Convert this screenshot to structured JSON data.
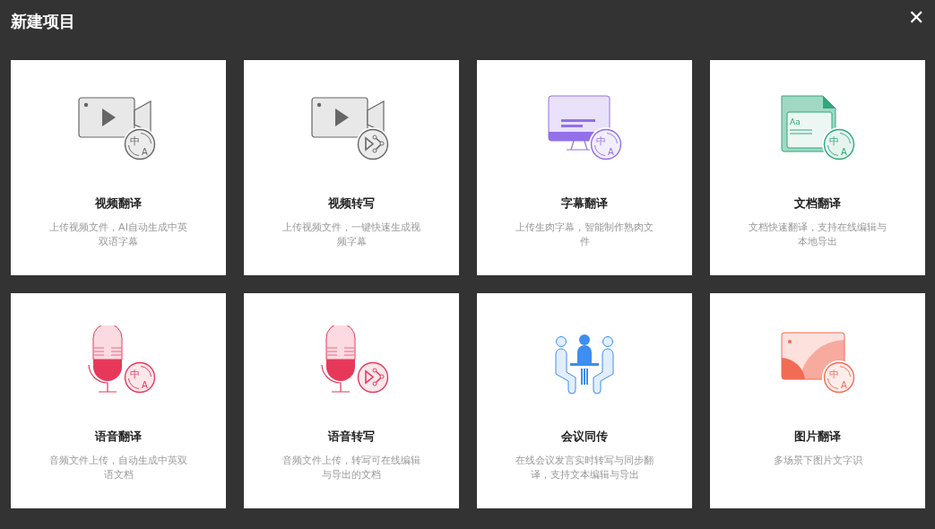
{
  "dialog": {
    "title": "新建项目",
    "close": "✕"
  },
  "cards": [
    {
      "title": "视频翻译",
      "description": "上传视频文件，AI自动生成中英双语字幕",
      "kind": "video",
      "icon_text": [
        "中",
        "A"
      ]
    },
    {
      "title": "视频转写",
      "description": "上传视频文件，一键快速生成视频字幕",
      "kind": "video"
    },
    {
      "title": "字幕翻译",
      "description": "上传生肉字幕，智能制作熟肉文件",
      "kind": "monitor",
      "icon_text": [
        "中",
        "A"
      ]
    },
    {
      "title": "文档翻译",
      "description": "文档快速翻译，支持在线编辑与本地导出",
      "kind": "document",
      "icon_text": [
        "中",
        "A",
        "Aa"
      ]
    },
    {
      "title": "语音翻译",
      "description": "音频文件上传，自动生成中英双语文档",
      "kind": "mic",
      "icon_text": [
        "中",
        "A"
      ]
    },
    {
      "title": "语音转写",
      "description": "音频文件上传，转写可在线编辑与导出的文档",
      "kind": "mic"
    },
    {
      "title": "会议同传",
      "description": "在线会议发言实时转写与同步翻译，支持文本编辑与导出",
      "kind": "meeting"
    },
    {
      "title": "图片翻译",
      "description": "多场景下图片文字识",
      "kind": "picture",
      "icon_text": [
        "中",
        "A"
      ]
    }
  ]
}
